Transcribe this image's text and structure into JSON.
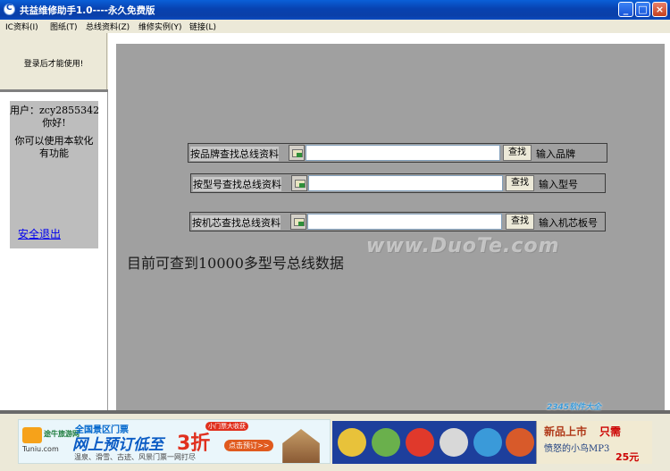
{
  "window": {
    "title": "共益维修助手1.0----永久免费版",
    "buttons": [
      "_",
      "□",
      "×"
    ]
  },
  "menu": [
    "IC资料(I)",
    "图纸(T)",
    "总线资料(Z)",
    "维修实例(Y)",
    "链接(L)"
  ],
  "login_note": "登录后才能使用!",
  "user": {
    "name_line": "用户：zcy2855342",
    "greeting": "你好!",
    "perm_line1": "你可以使用本软化",
    "perm_line2": "有功能",
    "logout": "安全退出"
  },
  "search": {
    "rows": [
      {
        "label": "按品牌查找总线资料",
        "value": "",
        "button": "查找",
        "hint": "输入品牌"
      },
      {
        "label": "按型号查找总线资料",
        "value": "",
        "button": "查找",
        "hint": "输入型号"
      },
      {
        "label": "按机芯查找总线资料",
        "value": "",
        "button": "查找",
        "hint": "输入机芯板号"
      }
    ],
    "count_text": "目前可查到10000多型号总线数据"
  },
  "watermark": "www.DuoTe.com",
  "ads": {
    "tuniu": {
      "logo_name": "途牛旅游网",
      "logo_url": "Tuniu.com",
      "head": "全国景区门票",
      "main": "网上预订低至",
      "discount": "3折",
      "tag": "小门票大收获",
      "book": "点击预订>>",
      "sub": "温泉、滑雪、古迹、风景门票一网打尽"
    },
    "mp3": {
      "line1": "新品上市",
      "price_label": "只需",
      "line2": "愤怒的小鸟MP3",
      "price": "25元"
    }
  },
  "site_mark": "2345软件大全"
}
